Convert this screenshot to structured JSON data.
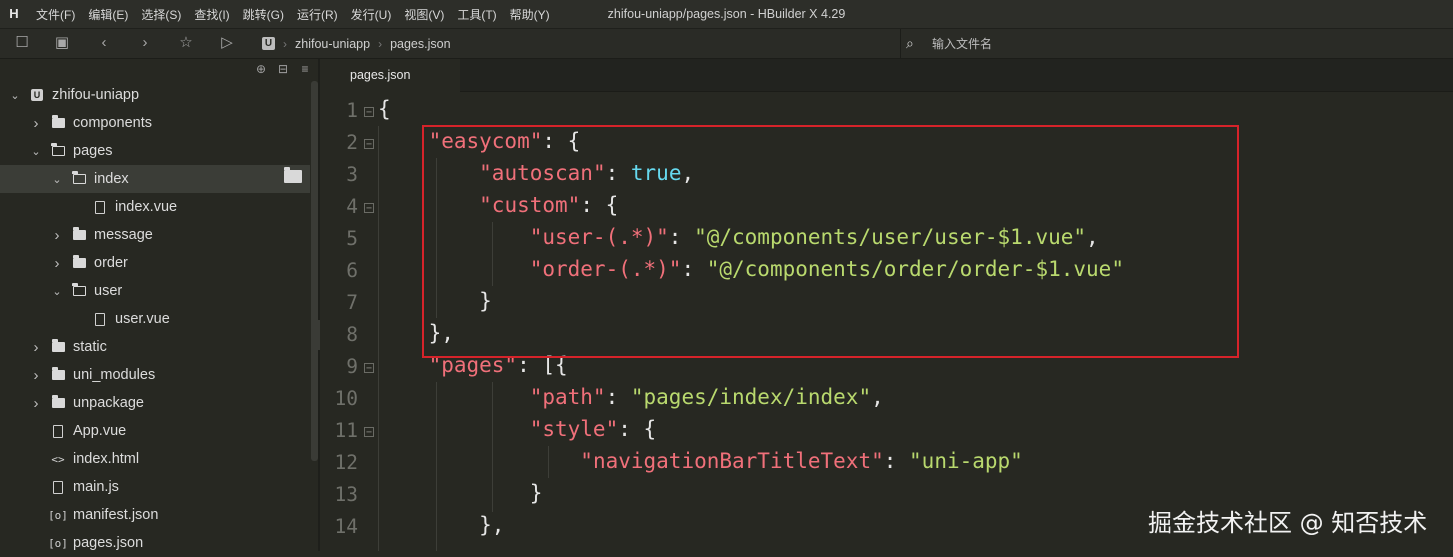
{
  "app": {
    "logo_glyph": "H",
    "window_title": "zhifou-uniapp/pages.json - HBuilder X 4.29",
    "menu": [
      "文件(F)",
      "编辑(E)",
      "选择(S)",
      "查找(I)",
      "跳转(G)",
      "运行(R)",
      "发行(U)",
      "视图(V)",
      "工具(T)",
      "帮助(Y)"
    ]
  },
  "toolbar": {
    "icons": [
      "new-file-icon",
      "save-icon",
      "back-icon",
      "forward-icon",
      "star-icon",
      "run-icon"
    ],
    "breadcrumb": {
      "project_badge": "U",
      "project": "zhifou-uniapp",
      "file": "pages.json"
    },
    "search_placeholder": "输入文件名"
  },
  "explorer": {
    "items": [
      {
        "label": "zhifou-uniapp",
        "type": "project",
        "expanded": true
      },
      {
        "label": "components",
        "type": "folder",
        "expanded": false
      },
      {
        "label": "pages",
        "type": "folder",
        "expanded": true
      },
      {
        "label": "index",
        "type": "folder",
        "expanded": true,
        "selected": true
      },
      {
        "label": "index.vue",
        "type": "file"
      },
      {
        "label": "message",
        "type": "folder",
        "expanded": false
      },
      {
        "label": "order",
        "type": "folder",
        "expanded": false
      },
      {
        "label": "user",
        "type": "folder",
        "expanded": true
      },
      {
        "label": "user.vue",
        "type": "file"
      },
      {
        "label": "static",
        "type": "folder",
        "expanded": false
      },
      {
        "label": "uni_modules",
        "type": "folder",
        "expanded": false
      },
      {
        "label": "unpackage",
        "type": "folder",
        "expanded": false
      },
      {
        "label": "App.vue",
        "type": "file"
      },
      {
        "label": "index.html",
        "type": "html"
      },
      {
        "label": "main.js",
        "type": "file"
      },
      {
        "label": "manifest.json",
        "type": "json"
      },
      {
        "label": "pages.json",
        "type": "json"
      }
    ]
  },
  "editor": {
    "tab": "pages.json",
    "line_numbers": [
      "1",
      "2",
      "3",
      "4",
      "5",
      "6",
      "7",
      "8",
      "9",
      "10",
      "11",
      "12",
      "13",
      "14"
    ],
    "lines": {
      "l1": "{",
      "l2_key": "\"easycom\"",
      "l2_rest": ": {",
      "l3_key": "\"autoscan\"",
      "l3_sep": ": ",
      "l3_val": "true",
      "l3_end": ",",
      "l4_key": "\"custom\"",
      "l4_rest": ": {",
      "l5_key": "\"user-(.*)\"",
      "l5_sep": ": ",
      "l5_val": "\"@/components/user/user-$1.vue\"",
      "l5_end": ",",
      "l6_key": "\"order-(.*)\"",
      "l6_sep": ": ",
      "l6_val": "\"@/components/order/order-$1.vue\"",
      "l7": "}",
      "l8": "},",
      "l9_key": "\"pages\"",
      "l9_rest": ": [{",
      "l10_key": "\"path\"",
      "l10_sep": ": ",
      "l10_val": "\"pages/index/index\"",
      "l10_end": ",",
      "l11_key": "\"style\"",
      "l11_rest": ": {",
      "l12_key": "\"navigationBarTitleText\"",
      "l12_sep": ": ",
      "l12_val": "\"uni-app\"",
      "l13": "}",
      "l14": "},"
    }
  },
  "colors": {
    "highlight_box": "#d6232a",
    "key": "#f0707a",
    "string": "#b9d96e",
    "boolean": "#66d9ef"
  },
  "watermark": "掘金技术社区 @ 知否技术"
}
